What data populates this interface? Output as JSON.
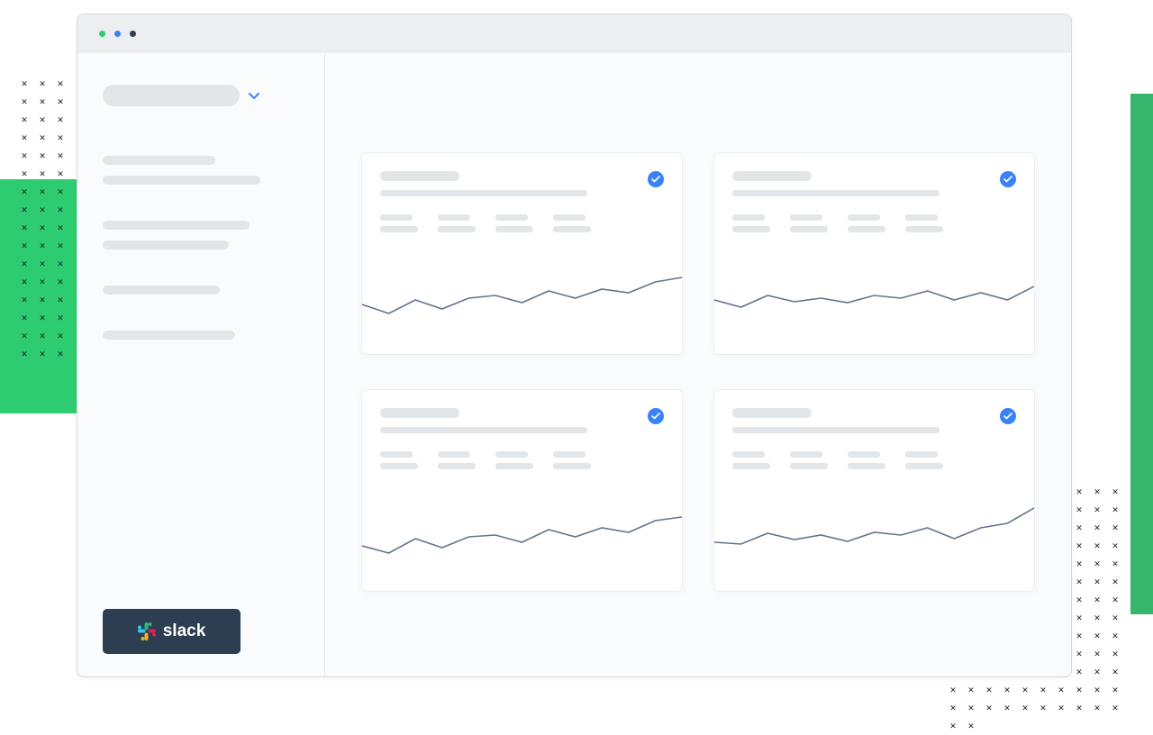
{
  "sidebar": {
    "integration_label": "slack"
  },
  "cards": [
    {
      "sparkline": [
        65,
        75,
        60,
        70,
        58,
        55,
        63,
        50,
        58,
        48,
        52,
        40,
        35
      ]
    },
    {
      "sparkline": [
        60,
        68,
        55,
        62,
        58,
        63,
        55,
        58,
        50,
        60,
        52,
        60,
        45
      ]
    },
    {
      "sparkline": [
        70,
        78,
        62,
        72,
        60,
        58,
        66,
        52,
        60,
        50,
        55,
        42,
        38
      ]
    },
    {
      "sparkline": [
        66,
        68,
        56,
        63,
        58,
        65,
        55,
        58,
        50,
        62,
        50,
        45,
        28
      ]
    }
  ]
}
